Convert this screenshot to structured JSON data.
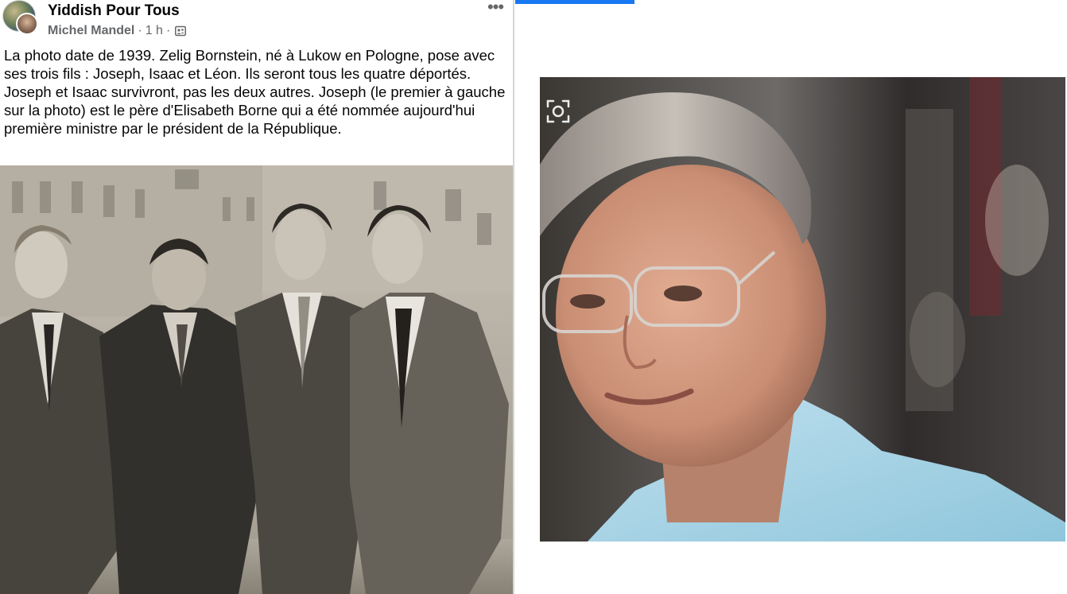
{
  "post": {
    "page_name": "Yiddish Pour Tous",
    "author": "Michel Mandel",
    "separator1": "·",
    "time": "1 h",
    "separator2": "·",
    "body_text": "La photo date de 1939. Zelig Bornstein, né à Lukow en Pologne, pose avec ses trois fils : Joseph, Isaac et Léon. Ils seront tous les quatre déportés. Joseph et Isaac survivront, pas les deux autres. Joseph (le premier à gauche sur la photo) est le père d'Elisabeth Borne qui a été nommée aujourd'hui première ministre par le président de la République.",
    "more_icon": "more-horizontal-icon",
    "audience_icon": "group-audience-icon"
  },
  "images": {
    "historic_photo": "black-and-white photograph of four men in suits on a street",
    "portrait_photo": "color portrait of a woman with grey hair and glasses in a light blue jacket"
  },
  "colors": {
    "accent_blue": "#1877f2",
    "text_primary": "#050505",
    "text_secondary": "#65676b"
  }
}
